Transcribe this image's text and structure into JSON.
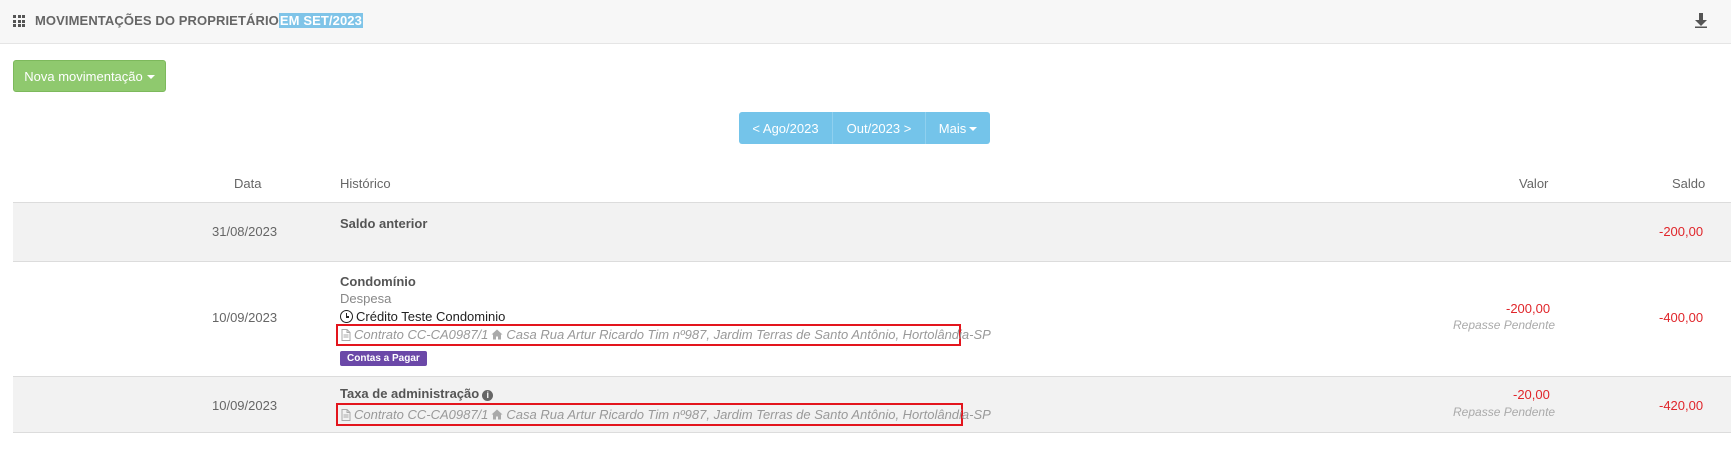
{
  "header": {
    "title": "MOVIMENTAÇÕES DO PROPRIETÁRIO",
    "title_highlight": "EM SET/2023"
  },
  "toolbar": {
    "nova_label": "Nova movimentação"
  },
  "pager": {
    "prev_label": "< Ago/2023",
    "next_label": "Out/2023 >",
    "more_label": "Mais"
  },
  "table": {
    "headers": {
      "data": "Data",
      "historico": "Histórico",
      "valor": "Valor",
      "saldo": "Saldo"
    },
    "rows": [
      {
        "date": "31/08/2023",
        "title": "Saldo anterior",
        "saldo": "-200,00"
      },
      {
        "date": "10/09/2023",
        "title": "Condomínio",
        "subtitle": "Despesa",
        "credit": "Crédito Teste Condominio",
        "contract": "Contrato CC-CA0987/1",
        "address": "Casa Rua Artur Ricardo Tim nº987, Jardim Terras de Santo Antônio, Hortolândia-SP",
        "badge": "Contas a Pagar",
        "valor": "-200,00",
        "status": "Repasse Pendente",
        "saldo": "-400,00"
      },
      {
        "date": "10/09/2023",
        "title": "Taxa de administração",
        "contract": "Contrato CC-CA0987/1",
        "address": "Casa Rua Artur Ricardo Tim nº987, Jardim Terras de Santo Antônio, Hortolândia-SP",
        "valor": "-20,00",
        "status": "Repasse Pendente",
        "saldo": "-420,00"
      }
    ]
  },
  "colors": {
    "negative": "#e0262b",
    "button_green": "#8fc96e",
    "pager_blue": "#74c4ea",
    "badge_purple": "#6b48a8",
    "highlight_box": "#e3151d"
  }
}
